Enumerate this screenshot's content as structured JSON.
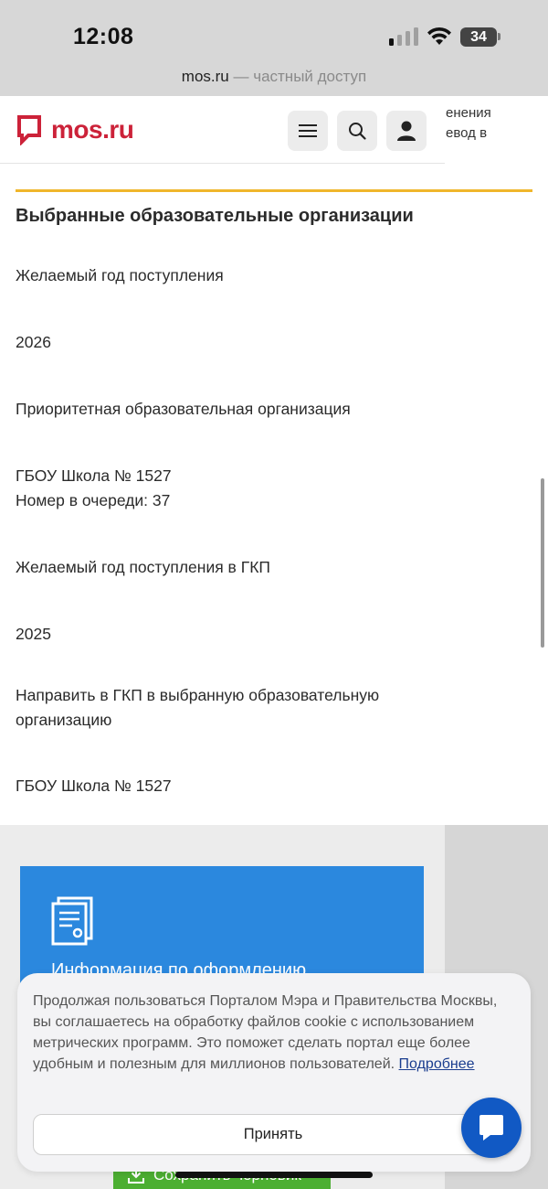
{
  "status_bar": {
    "time": "12:08",
    "battery_level": "34",
    "signal_bars_active": 1,
    "signal_bars_total": 4
  },
  "browser": {
    "domain": "mos.ru",
    "suffix": " — частный доступ"
  },
  "header": {
    "logo_text": "mos.ru",
    "brand_color": "#cc2239",
    "icons": [
      "menu-icon",
      "search-icon",
      "user-icon"
    ],
    "overflow_text": "енения\nевод в"
  },
  "section": {
    "title": "Выбранные образовательные организации",
    "rows": [
      "Желаемый год поступления",
      "2026",
      "Приоритетная образовательная организация",
      "ГБОУ Школа № 1527",
      "Номер в очереди: 37",
      "Желаемый год поступления в ГКП",
      "2025",
      "Направить в ГКП в выбранную образовательную организацию",
      "ГБОУ Школа № 1527"
    ]
  },
  "info_card": {
    "text": "Информация по оформлению",
    "icon": "document-icon",
    "color": "#2b88de"
  },
  "save_draft": {
    "label": "Сохранить черновик",
    "icon": "download-icon"
  },
  "cookie_banner": {
    "text": "Продолжая пользоваться Порталом Мэра и Правительства Москвы, вы соглашаетесь на обработку файлов cookie с использованием метрических программ. Это поможет сделать портал еще более удобным и полезным для миллионов пользователей.",
    "link": "Подробнее",
    "accept_label": "Принять"
  },
  "chat": {
    "icon": "chat-icon"
  }
}
